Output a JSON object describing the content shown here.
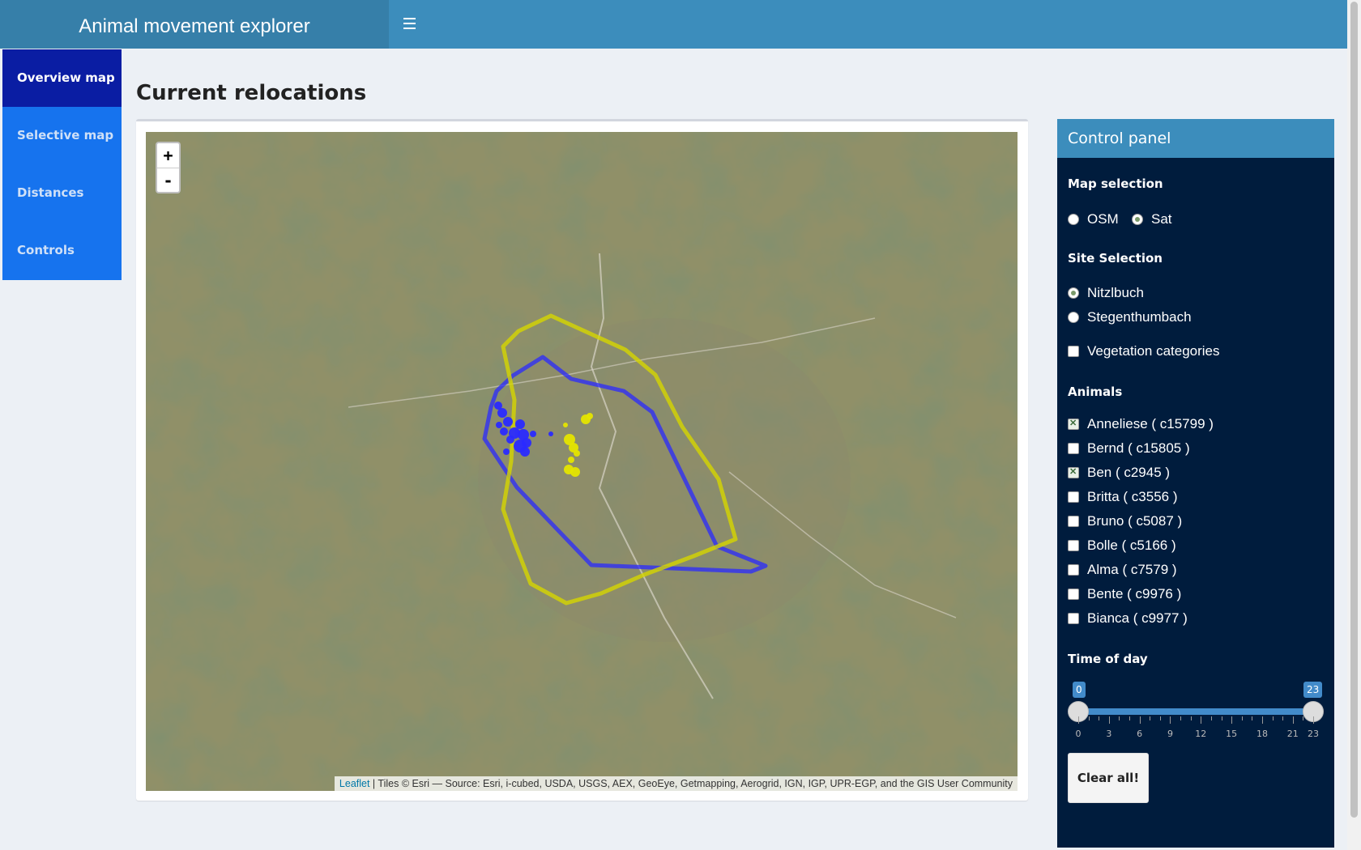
{
  "header": {
    "title": "Animal movement explorer"
  },
  "sidebar": {
    "items": [
      {
        "label": "Overview map"
      },
      {
        "label": "Selective map"
      },
      {
        "label": "Distances"
      },
      {
        "label": "Controls"
      }
    ]
  },
  "main": {
    "title": "Current relocations",
    "map": {
      "zoom_in": "+",
      "zoom_out": "-",
      "attribution_link": "Leaflet",
      "attribution_text": " | Tiles © Esri — Source: Esri, i-cubed, USDA, USGS, AEX, GeoEye, Getmapping, Aerogrid, IGN, IGP, UPR-EGP, and the GIS User Community"
    }
  },
  "panel": {
    "title": "Control panel",
    "map_selection": {
      "label": "Map selection",
      "options": [
        "OSM",
        "Sat"
      ],
      "selected": "Sat"
    },
    "site_selection": {
      "label": "Site Selection",
      "options": [
        "Nitzlbuch",
        "Stegenthumbach"
      ],
      "selected": "Nitzlbuch"
    },
    "vegetation": {
      "label": "Vegetation categories",
      "checked": false
    },
    "animals": {
      "label": "Animals",
      "items": [
        {
          "label": "Anneliese ( c15799 )",
          "checked": true
        },
        {
          "label": "Bernd ( c15805 )",
          "checked": false
        },
        {
          "label": "Ben ( c2945 )",
          "checked": true
        },
        {
          "label": "Britta ( c3556 )",
          "checked": false
        },
        {
          "label": "Bruno ( c5087 )",
          "checked": false
        },
        {
          "label": "Bolle ( c5166 )",
          "checked": false
        },
        {
          "label": "Alma ( c7579 )",
          "checked": false
        },
        {
          "label": "Bente ( c9976 )",
          "checked": false
        },
        {
          "label": "Bianca ( c9977 )",
          "checked": false
        }
      ]
    },
    "time_of_day": {
      "label": "Time of day",
      "min": 0,
      "max": 23,
      "from": "0",
      "to": "23",
      "tick_labels": [
        "0",
        "3",
        "6",
        "9",
        "12",
        "15",
        "18",
        "21",
        "23"
      ]
    },
    "clear_button": "Clear all!"
  },
  "colors": {
    "header": "#3c8dbc",
    "sidebar": "#1673ee",
    "sidebar_active": "#0a1da3",
    "panel": "#001c3d",
    "track_blue": "#2a2aff",
    "track_yellow": "#e5e500"
  }
}
